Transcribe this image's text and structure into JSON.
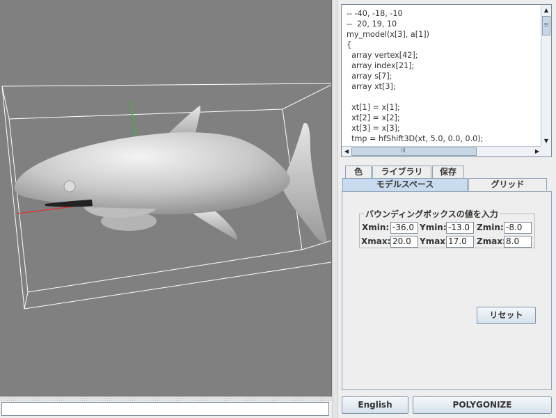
{
  "code_editor": {
    "lines": [
      "-- -40, -18, -10",
      "--  20, 19, 10",
      "my_model(x[3], a[1])",
      "{",
      "  array vertex[42];",
      "  array index[21];",
      "  array s[7];",
      "  array xt[3];",
      "",
      "  xt[1] = x[1];",
      "  xt[2] = x[2];",
      "  xt[3] = x[3];",
      "  tmp = hfShift3D(xt, 5.0, 0.0, 0.0);"
    ]
  },
  "tabs": {
    "row1": [
      "色",
      "ライブラリ",
      "保存"
    ],
    "row2": [
      "モデルスペース",
      "グリッド"
    ],
    "selected": "モデルスペース"
  },
  "bounding_box": {
    "title": "バウンディングボックスの値を入力",
    "xmin_label": "Xmin:",
    "xmin": "-36.0",
    "ymin_label": "Ymin:",
    "ymin": "-13.0",
    "zmin_label": "Zmin:",
    "zmin": "-8.0",
    "xmax_label": "Xmax:",
    "xmax": "20.0",
    "ymax_label": "Ymax:",
    "ymax": "17.0",
    "zmax_label": "Zmax:",
    "zmax": "8.0"
  },
  "buttons": {
    "reset": "リセット",
    "language": "English",
    "polygonize": "POLYGONIZE"
  },
  "console": {
    "value": ""
  },
  "colors": {
    "viewport_bg": "#808080",
    "axis_x": "#e03030",
    "axis_y": "#30c030",
    "selected_tab": "#c9dcef"
  }
}
